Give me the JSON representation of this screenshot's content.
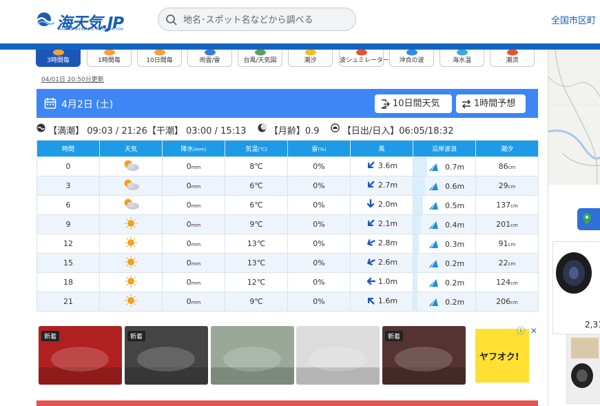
{
  "header": {
    "logo_text": "海天気.JP",
    "logo_sub": "MARINE WEATHER INFORMATION",
    "search_placeholder": "地名･スポット名などから調べる",
    "area_link": "全国市区町"
  },
  "tabs": [
    {
      "label": "3時間毎",
      "active": true,
      "icon": "sun-cloud-icon"
    },
    {
      "label": "1時間毎",
      "active": false,
      "icon": "sun-cloud-icon"
    },
    {
      "label": "10日間毎",
      "active": false,
      "icon": "sun-cloud-icon"
    },
    {
      "label": "雨雲/雷",
      "active": false,
      "icon": "rain-cloud-icon"
    },
    {
      "label": "台風/天気図",
      "active": false,
      "icon": "typhoon-icon"
    },
    {
      "label": "潮汐",
      "active": false,
      "icon": "tide-icon"
    },
    {
      "label": "波シュミレーター",
      "active": false,
      "icon": "wave-sim-icon"
    },
    {
      "label": "沖合の波",
      "active": false,
      "icon": "wave-icon"
    },
    {
      "label": "海水温",
      "active": false,
      "icon": "water-temp-icon"
    },
    {
      "label": "潮流",
      "active": false,
      "icon": "current-icon"
    }
  ],
  "updated": "04/01日 20:50分更新",
  "day": {
    "date": "4月2日 (土)",
    "btn_10day": "10日間天気",
    "btn_1hour": "1時間予想"
  },
  "info": {
    "tide": "【満潮】 09:03 / 21:26【干潮】 03:00 / 15:13",
    "moon": "【月齢】0.9",
    "sun": "【日出/日入】06:05/18:32"
  },
  "table": {
    "headers": {
      "time": "時間",
      "weather": "天気",
      "rain": "降水",
      "rain_unit": "(mm)",
      "temp": "気温",
      "temp_unit": "(℃)",
      "cloud": "雷",
      "cloud_unit": "(%)",
      "wind": "風",
      "wave": "沿岸波浪",
      "tide": "潮汐"
    },
    "rows": [
      {
        "time": "0",
        "weather": "sun-cloud",
        "rain": "0",
        "temp": "8",
        "cloud": "0%",
        "wind": "3.6m",
        "wind_dir": "sw",
        "wave": "0.7m",
        "wave_level": 0.7,
        "tide": "86"
      },
      {
        "time": "3",
        "weather": "sun-cloud",
        "rain": "0",
        "temp": "6",
        "cloud": "0%",
        "wind": "2.7m",
        "wind_dir": "sw",
        "wave": "0.6m",
        "wave_level": 0.6,
        "tide": "29"
      },
      {
        "time": "6",
        "weather": "sun-cloud",
        "rain": "0",
        "temp": "6",
        "cloud": "0%",
        "wind": "2.0m",
        "wind_dir": "s",
        "wave": "0.5m",
        "wave_level": 0.5,
        "tide": "137"
      },
      {
        "time": "9",
        "weather": "sun",
        "rain": "0",
        "temp": "9",
        "cloud": "0%",
        "wind": "2.1m",
        "wind_dir": "sw",
        "wave": "0.4m",
        "wave_level": 0.4,
        "tide": "201"
      },
      {
        "time": "12",
        "weather": "sun",
        "rain": "0",
        "temp": "13",
        "cloud": "0%",
        "wind": "2.8m",
        "wind_dir": "wsw",
        "wave": "0.3m",
        "wave_level": 0.3,
        "tide": "91"
      },
      {
        "time": "15",
        "weather": "sun",
        "rain": "0",
        "temp": "13",
        "cloud": "0%",
        "wind": "2.6m",
        "wind_dir": "wsw",
        "wave": "0.2m",
        "wave_level": 0.2,
        "tide": "22"
      },
      {
        "time": "18",
        "weather": "sun",
        "rain": "0",
        "temp": "12",
        "cloud": "0%",
        "wind": "1.0m",
        "wind_dir": "w",
        "wave": "0.2m",
        "wave_level": 0.2,
        "tide": "124"
      },
      {
        "time": "21",
        "weather": "sun",
        "rain": "0",
        "temp": "9",
        "cloud": "0%",
        "wind": "1.6m",
        "wind_dir": "nw",
        "wave": "0.2m",
        "wave_level": 0.2,
        "tide": "206"
      }
    ],
    "units": {
      "rain": "mm",
      "temp": "℃",
      "tide": "cm"
    }
  },
  "ads": {
    "new_badge": "新着",
    "items": [
      {
        "color": "#b02020",
        "new": true
      },
      {
        "color": "#444444",
        "new": true
      },
      {
        "color": "#9aa89a",
        "new": false
      },
      {
        "color": "#dcdcdc",
        "new": false
      },
      {
        "color": "#553333",
        "new": true
      }
    ],
    "yahoo_label": "ヤフオク!",
    "info_icon": "ⓘ",
    "close_icon": "✕"
  },
  "sidebar": {
    "price": "2,31"
  },
  "colors": {
    "brand": "#1565c0",
    "day_bar": "#3e86f5",
    "table_header": "#1e9be6",
    "ad_bottom": "#e5544e"
  }
}
